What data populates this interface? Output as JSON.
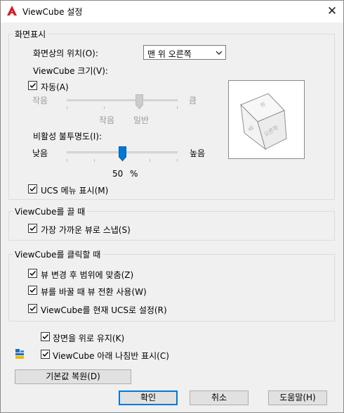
{
  "window": {
    "title": "ViewCube 설정",
    "close_glyph": "✕"
  },
  "display_group": {
    "title": "화면표시",
    "position_label": "화면상의 위치(O):",
    "position_value": "맨 위 오른쪽",
    "size_label": "ViewCube 크기(V):",
    "auto_label": "자동(A)",
    "auto_checked": true,
    "size_min_label": "작음",
    "size_max_label": "큼",
    "size_tick_small": "작음",
    "size_tick_normal": "일반",
    "opacity_label": "비활성 불투명도(I):",
    "opacity_min_label": "낮음",
    "opacity_max_label": "높음",
    "opacity_value": "50",
    "opacity_unit": "%",
    "ucs_menu_label": "UCS 메뉴 표시(M)",
    "ucs_menu_checked": true
  },
  "drag_group": {
    "title": "ViewCube를 끌 때",
    "snap_label": "가장 가까운 뷰로 스냅(S)",
    "snap_checked": true
  },
  "click_group": {
    "title": "ViewCube를 클릭할 때",
    "fit_label": "뷰 변경 후 범위에 맞춤(Z)",
    "fit_checked": true,
    "transition_label": "뷰를 바꿀 때 뷰 전환 사용(W)",
    "transition_checked": true,
    "ucs_orient_label": "ViewCube를 현재 UCS로 설정(R)",
    "ucs_orient_checked": true
  },
  "options": {
    "keep_upright_label": "장면을 위로 유지(K)",
    "keep_upright_checked": true,
    "show_compass_label": "ViewCube 아래 나침반 표시(C)",
    "show_compass_checked": true
  },
  "buttons": {
    "restore_defaults": "기본값 복원(D)",
    "ok": "확인",
    "cancel": "취소",
    "help": "도움말(H)"
  },
  "preview": {
    "face_labels": [
      "위",
      "앞",
      "오른쪽"
    ]
  },
  "colors": {
    "accent": "#0078d7",
    "app_icon": "#d31d28"
  }
}
